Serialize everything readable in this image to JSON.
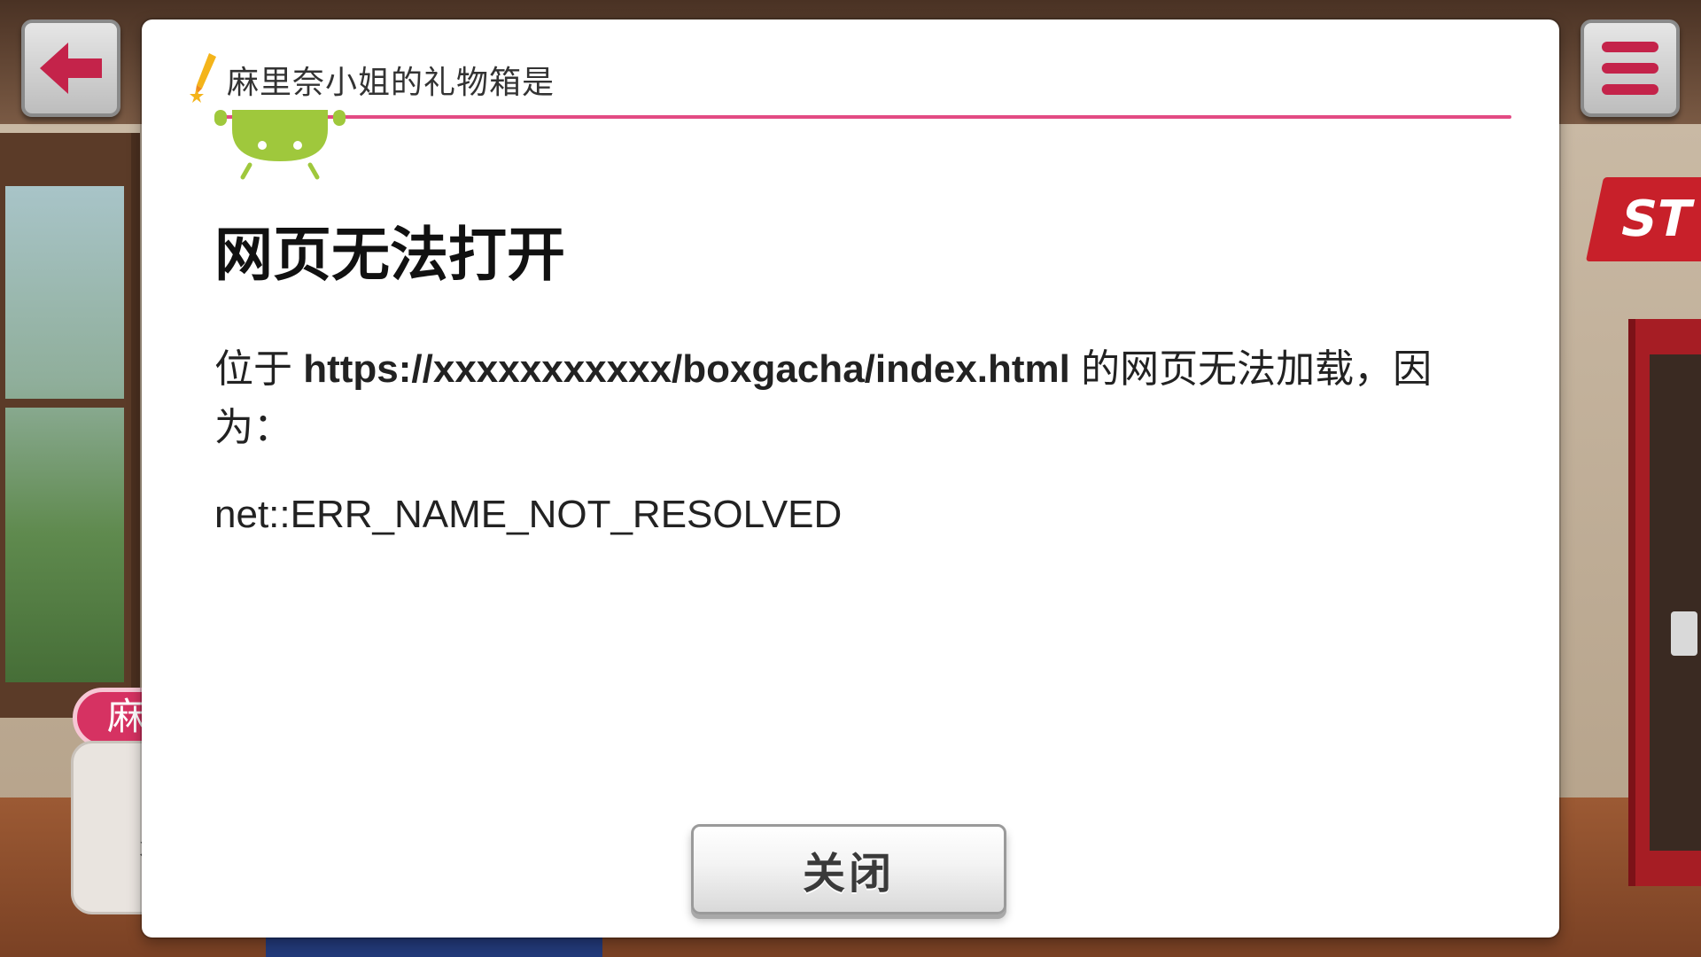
{
  "dialog": {
    "title": "麻里奈小姐的礼物箱是",
    "accent_color": "#e34b84",
    "close_label": "关闭"
  },
  "error_page": {
    "heading": "网页无法打开",
    "message_prefix": "位于 ",
    "url": "https://xxxxxxxxxxx/boxgacha/index.html",
    "message_suffix": " 的网页无法加载，因为：",
    "error_code": "net::ERR_NAME_NOT_RESOLVED",
    "icon": "android-robot-icon"
  },
  "hud": {
    "back_icon": "back-arrow-icon",
    "menu_icon": "hamburger-menu-icon"
  },
  "background": {
    "name_tag": "麻",
    "chat_text": "ゞ\n彳",
    "sign_text": "ST"
  }
}
